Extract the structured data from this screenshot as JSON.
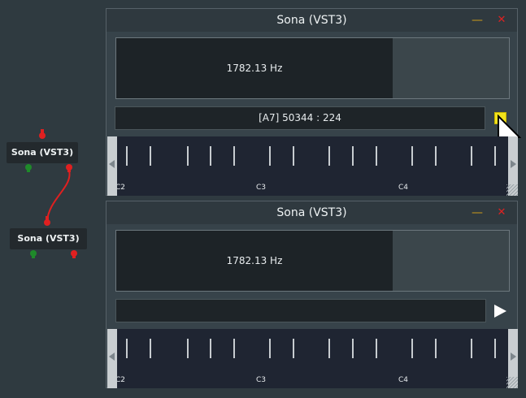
{
  "graph": {
    "nodes": [
      {
        "label": "Sona (VST3)"
      },
      {
        "label": "Sona (VST3)"
      }
    ]
  },
  "windows": [
    {
      "title": "Sona (VST3)",
      "minimize_label": "—",
      "close_label": "✕",
      "frequency": "1782.13 Hz",
      "info_text": "[A7] 50344 : 224",
      "keyboard_labels": [
        "C2",
        "C3",
        "C4"
      ]
    },
    {
      "title": "Sona (VST3)",
      "minimize_label": "—",
      "close_label": "✕",
      "frequency": "1782.13 Hz",
      "info_text": "",
      "keyboard_labels": [
        "C2",
        "C3",
        "C4"
      ]
    }
  ],
  "colors": {
    "stop_button": "#f2e21b",
    "play_button": "#ffffff",
    "cable": "#e02020"
  }
}
